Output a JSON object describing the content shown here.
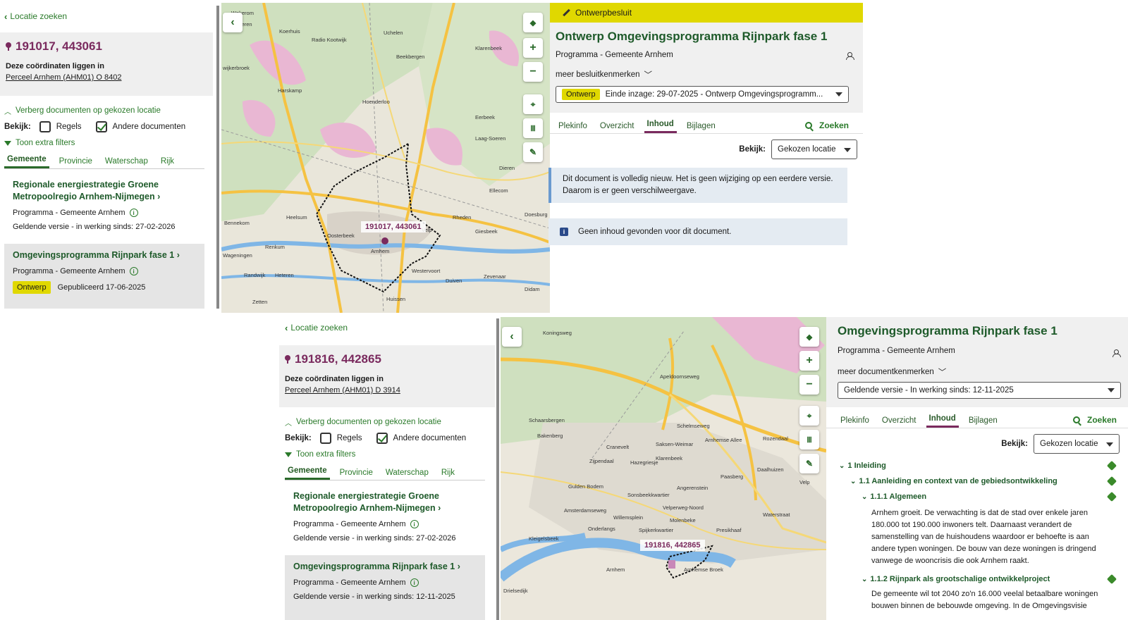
{
  "top": {
    "left": {
      "back_label": "Locatie zoeken",
      "coords": "191017, 443061",
      "coords_sub": "Deze coördinaten liggen in",
      "parcel": "Perceel Arnhem (AHM01) O 8402",
      "toggle_label": "Verberg documenten op gekozen locatie",
      "bekijk_label": "Bekijk:",
      "cb_regels": "Regels",
      "cb_andere": "Andere documenten",
      "filters_label": "Toon extra filters",
      "tabs": [
        "Gemeente",
        "Provincie",
        "Waterschap",
        "Rijk"
      ],
      "cards": [
        {
          "title": "Regionale energiestrategie Groene Metropoolregio Arnhem-Nijmegen",
          "line1": "Programma - Gemeente Arnhem",
          "line2": "Geldende versie - in werking sinds: 27-02-2026"
        },
        {
          "title": "Omgevingsprogramma Rijnpark fase 1",
          "line1": "Programma - Gemeente Arnhem",
          "badge": "Ontwerp",
          "line2": "Gepubliceerd 17-06-2025"
        }
      ]
    },
    "map": {
      "coord_tag": "191017, 443061",
      "labels": [
        "Koerhuis",
        "Radio Kootwijk",
        "Uchelen",
        "Beekbergen",
        "Klarenbeek",
        "Harskamp",
        "Hoenderloo",
        "Eerbeek",
        "Laag-Soeren",
        "Dieren",
        "Ellecom",
        "Bennekom",
        "Oosterbeek",
        "Renkum",
        "Arnhem",
        "Velp",
        "Rheden",
        "Giesbeek",
        "Randwijk",
        "Heteren",
        "Westervoort",
        "Duiven",
        "Huissen",
        "Zevenaar",
        "Didam",
        "Zetten",
        "Doesburg",
        "Wekerom",
        "Lunteren",
        "wijkerbroek",
        "Heelsum",
        "Wageningen"
      ]
    },
    "right": {
      "banner": "Ontwerpbesluit",
      "title": "Ontwerp Omgevingsprogramma Rijnpark fase 1",
      "subtitle": "Programma - Gemeente Arnhem",
      "meer": "meer besluitkenmerken",
      "select_badge": "Ontwerp",
      "select_text": "Einde inzage: 29-07-2025 - Ontwerp Omgevingsprogramm...",
      "tabs": [
        "Plekinfo",
        "Overzicht",
        "Inhoud",
        "Bijlagen"
      ],
      "zoek": "Zoeken",
      "bekijk_label": "Bekijk:",
      "bekijk_value": "Gekozen locatie",
      "msg1": "Dit document is volledig nieuw. Het is geen wijziging op een eerdere versie. Daarom is er geen verschilweergave.",
      "msg2": "Geen inhoud gevonden voor dit document."
    }
  },
  "bottom": {
    "left": {
      "back_label": "Locatie zoeken",
      "coords": "191816, 442865",
      "coords_sub": "Deze coördinaten liggen in",
      "parcel": "Perceel Arnhem (AHM01) D 3914",
      "toggle_label": "Verberg documenten op gekozen locatie",
      "bekijk_label": "Bekijk:",
      "cb_regels": "Regels",
      "cb_andere": "Andere documenten",
      "filters_label": "Toon extra filters",
      "tabs": [
        "Gemeente",
        "Provincie",
        "Waterschap",
        "Rijk"
      ],
      "cards": [
        {
          "title": "Regionale energiestrategie Groene Metropoolregio Arnhem-Nijmegen",
          "line1": "Programma - Gemeente Arnhem",
          "line2": "Geldende versie - in werking sinds: 27-02-2026"
        },
        {
          "title": "Omgevingsprogramma Rijnpark fase 1",
          "line1": "Programma - Gemeente Arnhem",
          "line2": "Geldende versie - in werking sinds: 12-11-2025"
        }
      ]
    },
    "map": {
      "coord_tag": "191816, 442865",
      "labels": [
        "Koningsweg",
        "Schaarsbergen",
        "Bakenberg",
        "Cranevelt",
        "Zijpendaal",
        "Hazegriesje",
        "Saksen-Weimar",
        "Klarenbeek",
        "Arnhemse Allee",
        "Rozendaal",
        "Paasberg",
        "Daalhuizen",
        "Angerenstein",
        "Velp",
        "Gulden Bodem",
        "Sonsbeekkwartier",
        "Velperweg-Noord",
        "Molenbeke",
        "Spijkerkwartier",
        "Presikhaaf",
        "Kleigelsbeek",
        "Onderlangs",
        "Arnhem",
        "Arnhemse Broek",
        "Drielsedijk",
        "Waterstraat",
        "Schelmseweg",
        "Apeldoornseweg",
        "Amsterdamseweg",
        "Willemsplein"
      ]
    },
    "right": {
      "title": "Omgevingsprogramma Rijnpark fase 1",
      "subtitle": "Programma - Gemeente Arnhem",
      "meer": "meer documentkenmerken",
      "select_text": "Geldende versie - In werking sinds: 12-11-2025",
      "tabs": [
        "Plekinfo",
        "Overzicht",
        "Inhoud",
        "Bijlagen"
      ],
      "zoek": "Zoeken",
      "bekijk_label": "Bekijk:",
      "bekijk_value": "Gekozen locatie",
      "toc": {
        "h1": "1 Inleiding",
        "h2": "1.1 Aanleiding en context van de gebiedsontwikkeling",
        "h3": "1.1.1 Algemeen",
        "p1": "Arnhem groeit. De verwachting is dat de stad over enkele jaren 180.000 tot 190.000 inwoners telt. Daarnaast verandert de samenstelling van de huishoudens waardoor er behoefte is aan andere typen woningen. De bouw van deze woningen is dringend vanwege de wooncrisis die ook Arnhem raakt.",
        "h4": "1.1.2 Rijnpark als grootschalige ontwikkelproject",
        "p2": "De gemeente wil tot 2040 zo'n 16.000 veelal betaalbare woningen bouwen binnen de bebouwde omgeving. In de Omgevingsvisie"
      }
    }
  },
  "colors": {
    "green": "#2a7a2a",
    "ontwerp_yellow": "#e0d800",
    "purple": "#7a2a5e"
  }
}
